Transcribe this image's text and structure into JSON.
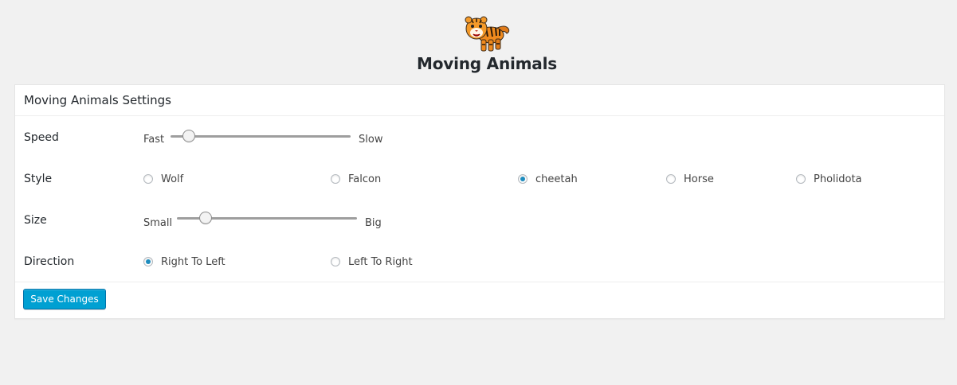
{
  "header": {
    "logo_icon": "tiger-icon",
    "title": "Moving Animals"
  },
  "settings": {
    "heading": "Moving Animals Settings",
    "speed": {
      "label": "Speed",
      "min_label": "Fast",
      "max_label": "Slow",
      "value_fraction": 0.1
    },
    "style": {
      "label": "Style",
      "options": [
        "Wolf",
        "Falcon",
        "cheetah",
        "Horse",
        "Pholidota"
      ],
      "selected": "cheetah"
    },
    "size": {
      "label": "Size",
      "min_label": "Small",
      "max_label": "Big",
      "value_fraction": 0.16
    },
    "direction": {
      "label": "Direction",
      "options": [
        "Right To Left",
        "Left To Right"
      ],
      "selected": "Right To Left"
    }
  },
  "actions": {
    "save_label": "Save Changes"
  },
  "colors": {
    "accent": "#00a0d2",
    "radio_checked": "#1e8cbe",
    "background": "#f1f1f1"
  }
}
